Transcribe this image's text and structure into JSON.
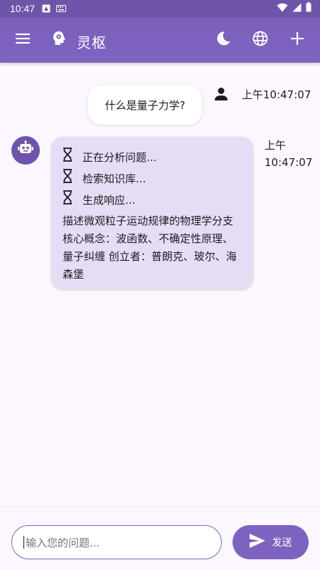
{
  "status_bar": {
    "time": "10:47",
    "icons": [
      "android-icon",
      "keyboard-icon",
      "wifi-icon",
      "signal-icon",
      "battery-icon"
    ]
  },
  "app_bar": {
    "title": "灵枢",
    "icons": [
      "menu-icon",
      "brain-icon",
      "dark-mode-icon",
      "globe-icon",
      "add-icon"
    ]
  },
  "chat": {
    "messages": [
      {
        "role": "user",
        "text": "什么是量子力学?",
        "time": "上午10:47:07",
        "icon": "person-icon"
      },
      {
        "role": "bot",
        "icon": "robot-icon",
        "time_line1": "上午",
        "time_line2": "10:47:07",
        "steps": [
          "正在分析问题...",
          "检索知识库...",
          "生成响应..."
        ],
        "step_icon": "hourglass-icon",
        "answer": "描述微观粒子运动规律的物理学分支 核心概念：波函数、不确定性原理、量子纠缠 创立者：普朗克、玻尔、海森堡"
      }
    ]
  },
  "input": {
    "placeholder": "输入您的问题...",
    "send_label": "发送",
    "send_icon": "send-icon"
  },
  "colors": {
    "primary": "#7e62bf",
    "status_bar": "#6e55aa",
    "bot_bubble": "#e6ddf5",
    "background": "#fcf7ff"
  }
}
